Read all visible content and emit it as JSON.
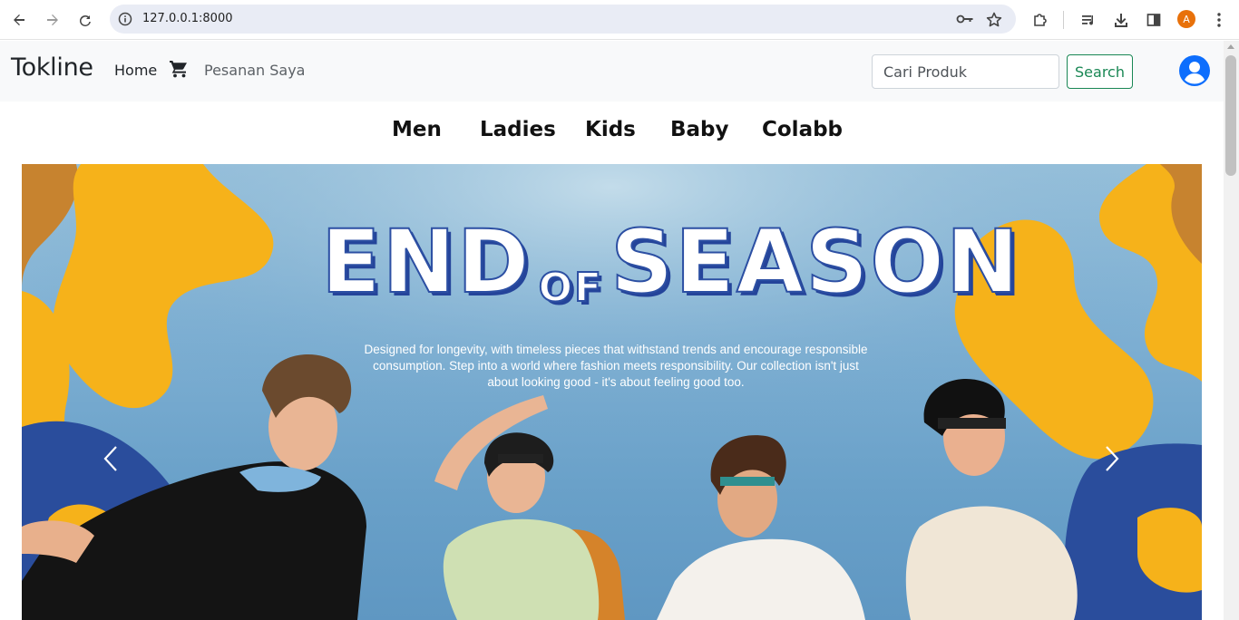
{
  "browser": {
    "url": "127.0.0.1:8000",
    "profile_initial": "A"
  },
  "navbar": {
    "brand": "Tokline",
    "home_label": "Home",
    "orders_label": "Pesanan Saya",
    "search_placeholder": "Cari Produk",
    "search_button": "Search"
  },
  "categories": [
    "Men",
    "Ladies",
    "Kids",
    "Baby",
    "Colabb"
  ],
  "banner": {
    "title_left": "END",
    "title_mid": "OF",
    "title_right": "SEASON",
    "description": "Designed for longevity, with timeless pieces that withstand trends and encourage responsible consumption. Step into a world where fashion meets responsibility. Our collection isn't just about looking good - it's about feeling good too."
  },
  "colors": {
    "accent_green": "#198754",
    "user_icon_blue": "#0d6efd",
    "banner_yellow": "#f6b21a",
    "banner_navy": "#2a4d9c"
  }
}
